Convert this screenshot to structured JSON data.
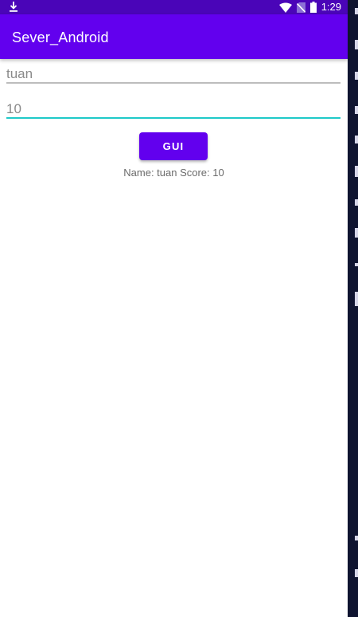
{
  "status_bar": {
    "time": "1:29",
    "icons": [
      "download-icon",
      "wifi-icon",
      "no-sim-icon",
      "battery-icon"
    ]
  },
  "app_bar": {
    "title": "Sever_Android"
  },
  "name_field": {
    "value": "tuan"
  },
  "score_field": {
    "value": "10"
  },
  "send_button": {
    "label": "GUI"
  },
  "result": {
    "text": "Name: tuan Score: 10"
  },
  "colors": {
    "primary": "#6200ee",
    "status_bar": "#4a05b8",
    "focus_underline": "#1fc9c8",
    "background": "#ffffff"
  }
}
